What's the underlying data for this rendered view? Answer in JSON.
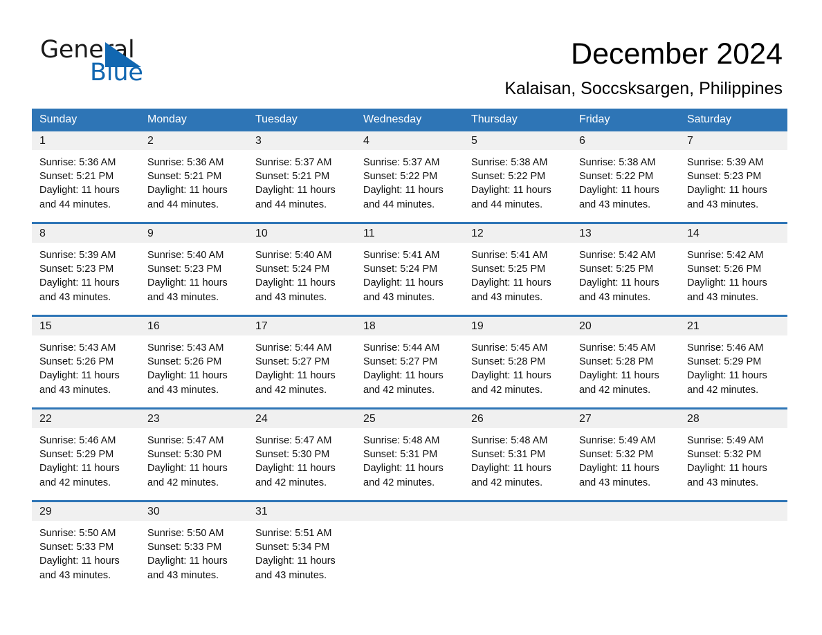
{
  "brand": {
    "word_one": "General",
    "word_two": "Blue",
    "triangle_color": "#1167b1",
    "logo_name": "general-blue-logo"
  },
  "header": {
    "title": "December 2024",
    "subtitle": "Kalaisan, Soccsksargen, Philippines"
  },
  "theme": {
    "header_blue": "#2e75b6",
    "band_grey": "#f0f0f0",
    "text_black": "#000000"
  },
  "calendar": {
    "weekday_headers": [
      "Sunday",
      "Monday",
      "Tuesday",
      "Wednesday",
      "Thursday",
      "Friday",
      "Saturday"
    ],
    "weeks": [
      [
        {
          "day": "1",
          "sunrise": "Sunrise: 5:36 AM",
          "sunset": "Sunset: 5:21 PM",
          "daylight": "Daylight: 11 hours and 44 minutes."
        },
        {
          "day": "2",
          "sunrise": "Sunrise: 5:36 AM",
          "sunset": "Sunset: 5:21 PM",
          "daylight": "Daylight: 11 hours and 44 minutes."
        },
        {
          "day": "3",
          "sunrise": "Sunrise: 5:37 AM",
          "sunset": "Sunset: 5:21 PM",
          "daylight": "Daylight: 11 hours and 44 minutes."
        },
        {
          "day": "4",
          "sunrise": "Sunrise: 5:37 AM",
          "sunset": "Sunset: 5:22 PM",
          "daylight": "Daylight: 11 hours and 44 minutes."
        },
        {
          "day": "5",
          "sunrise": "Sunrise: 5:38 AM",
          "sunset": "Sunset: 5:22 PM",
          "daylight": "Daylight: 11 hours and 44 minutes."
        },
        {
          "day": "6",
          "sunrise": "Sunrise: 5:38 AM",
          "sunset": "Sunset: 5:22 PM",
          "daylight": "Daylight: 11 hours and 43 minutes."
        },
        {
          "day": "7",
          "sunrise": "Sunrise: 5:39 AM",
          "sunset": "Sunset: 5:23 PM",
          "daylight": "Daylight: 11 hours and 43 minutes."
        }
      ],
      [
        {
          "day": "8",
          "sunrise": "Sunrise: 5:39 AM",
          "sunset": "Sunset: 5:23 PM",
          "daylight": "Daylight: 11 hours and 43 minutes."
        },
        {
          "day": "9",
          "sunrise": "Sunrise: 5:40 AM",
          "sunset": "Sunset: 5:23 PM",
          "daylight": "Daylight: 11 hours and 43 minutes."
        },
        {
          "day": "10",
          "sunrise": "Sunrise: 5:40 AM",
          "sunset": "Sunset: 5:24 PM",
          "daylight": "Daylight: 11 hours and 43 minutes."
        },
        {
          "day": "11",
          "sunrise": "Sunrise: 5:41 AM",
          "sunset": "Sunset: 5:24 PM",
          "daylight": "Daylight: 11 hours and 43 minutes."
        },
        {
          "day": "12",
          "sunrise": "Sunrise: 5:41 AM",
          "sunset": "Sunset: 5:25 PM",
          "daylight": "Daylight: 11 hours and 43 minutes."
        },
        {
          "day": "13",
          "sunrise": "Sunrise: 5:42 AM",
          "sunset": "Sunset: 5:25 PM",
          "daylight": "Daylight: 11 hours and 43 minutes."
        },
        {
          "day": "14",
          "sunrise": "Sunrise: 5:42 AM",
          "sunset": "Sunset: 5:26 PM",
          "daylight": "Daylight: 11 hours and 43 minutes."
        }
      ],
      [
        {
          "day": "15",
          "sunrise": "Sunrise: 5:43 AM",
          "sunset": "Sunset: 5:26 PM",
          "daylight": "Daylight: 11 hours and 43 minutes."
        },
        {
          "day": "16",
          "sunrise": "Sunrise: 5:43 AM",
          "sunset": "Sunset: 5:26 PM",
          "daylight": "Daylight: 11 hours and 43 minutes."
        },
        {
          "day": "17",
          "sunrise": "Sunrise: 5:44 AM",
          "sunset": "Sunset: 5:27 PM",
          "daylight": "Daylight: 11 hours and 42 minutes."
        },
        {
          "day": "18",
          "sunrise": "Sunrise: 5:44 AM",
          "sunset": "Sunset: 5:27 PM",
          "daylight": "Daylight: 11 hours and 42 minutes."
        },
        {
          "day": "19",
          "sunrise": "Sunrise: 5:45 AM",
          "sunset": "Sunset: 5:28 PM",
          "daylight": "Daylight: 11 hours and 42 minutes."
        },
        {
          "day": "20",
          "sunrise": "Sunrise: 5:45 AM",
          "sunset": "Sunset: 5:28 PM",
          "daylight": "Daylight: 11 hours and 42 minutes."
        },
        {
          "day": "21",
          "sunrise": "Sunrise: 5:46 AM",
          "sunset": "Sunset: 5:29 PM",
          "daylight": "Daylight: 11 hours and 42 minutes."
        }
      ],
      [
        {
          "day": "22",
          "sunrise": "Sunrise: 5:46 AM",
          "sunset": "Sunset: 5:29 PM",
          "daylight": "Daylight: 11 hours and 42 minutes."
        },
        {
          "day": "23",
          "sunrise": "Sunrise: 5:47 AM",
          "sunset": "Sunset: 5:30 PM",
          "daylight": "Daylight: 11 hours and 42 minutes."
        },
        {
          "day": "24",
          "sunrise": "Sunrise: 5:47 AM",
          "sunset": "Sunset: 5:30 PM",
          "daylight": "Daylight: 11 hours and 42 minutes."
        },
        {
          "day": "25",
          "sunrise": "Sunrise: 5:48 AM",
          "sunset": "Sunset: 5:31 PM",
          "daylight": "Daylight: 11 hours and 42 minutes."
        },
        {
          "day": "26",
          "sunrise": "Sunrise: 5:48 AM",
          "sunset": "Sunset: 5:31 PM",
          "daylight": "Daylight: 11 hours and 42 minutes."
        },
        {
          "day": "27",
          "sunrise": "Sunrise: 5:49 AM",
          "sunset": "Sunset: 5:32 PM",
          "daylight": "Daylight: 11 hours and 43 minutes."
        },
        {
          "day": "28",
          "sunrise": "Sunrise: 5:49 AM",
          "sunset": "Sunset: 5:32 PM",
          "daylight": "Daylight: 11 hours and 43 minutes."
        }
      ],
      [
        {
          "day": "29",
          "sunrise": "Sunrise: 5:50 AM",
          "sunset": "Sunset: 5:33 PM",
          "daylight": "Daylight: 11 hours and 43 minutes."
        },
        {
          "day": "30",
          "sunrise": "Sunrise: 5:50 AM",
          "sunset": "Sunset: 5:33 PM",
          "daylight": "Daylight: 11 hours and 43 minutes."
        },
        {
          "day": "31",
          "sunrise": "Sunrise: 5:51 AM",
          "sunset": "Sunset: 5:34 PM",
          "daylight": "Daylight: 11 hours and 43 minutes."
        },
        {
          "day": "",
          "sunrise": "",
          "sunset": "",
          "daylight": ""
        },
        {
          "day": "",
          "sunrise": "",
          "sunset": "",
          "daylight": ""
        },
        {
          "day": "",
          "sunrise": "",
          "sunset": "",
          "daylight": ""
        },
        {
          "day": "",
          "sunrise": "",
          "sunset": "",
          "daylight": ""
        }
      ]
    ]
  }
}
